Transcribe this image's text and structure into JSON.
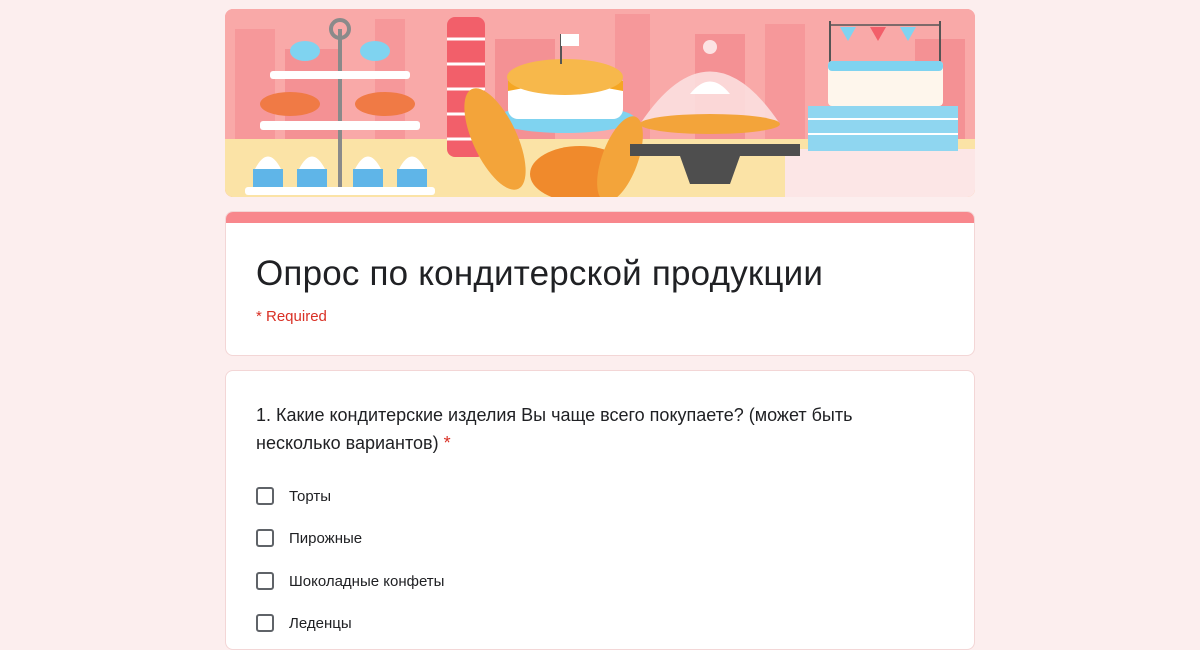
{
  "form": {
    "title": "Опрос по кондитерской продукции",
    "required_note": "* Required"
  },
  "question1": {
    "text": "1. Какие кондитерские изделия Вы чаще всего покупаете? (может быть несколько вариантов)",
    "required_marker": "*",
    "options": [
      {
        "label": "Торты"
      },
      {
        "label": "Пирожные"
      },
      {
        "label": "Шоколадные конфеты"
      },
      {
        "label": "Леденцы"
      }
    ]
  },
  "colors": {
    "page_background": "#fceeee",
    "theme_accent": "#f8878c",
    "required_red": "#d93025"
  },
  "icons": {
    "checkbox": "checkbox-unchecked-icon"
  }
}
